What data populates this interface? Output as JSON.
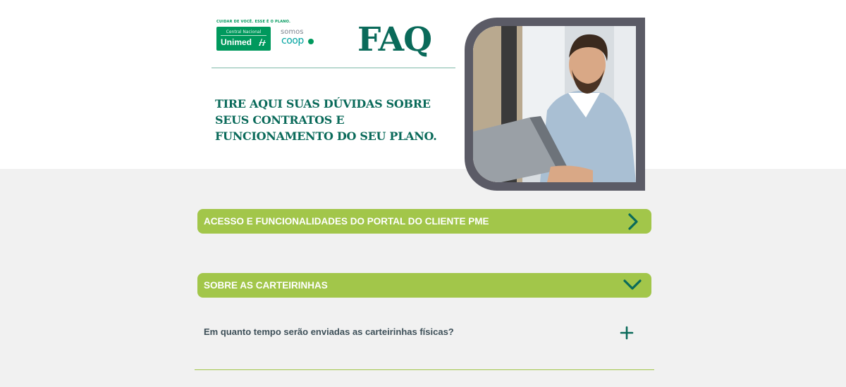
{
  "header": {
    "tagline": "CUIDAR DE VOCÊ. ESSE É O PLANO.",
    "unimed_logo": {
      "subtitle": "Central Nacional",
      "name": "Unimed"
    },
    "somos_coop": {
      "top": "somos",
      "bottom": "coop"
    },
    "title": "FAQ",
    "subtitle": "TIRE AQUI SUAS DÚVIDAS SOBRE SEUS CONTRATOS E FUNCIONAMENTO DO SEU PLANO."
  },
  "sections": [
    {
      "label": "ACESSO E FUNCIONALIDADES DO PORTAL DO CLIENTE PME",
      "state": "collapsed",
      "icon": "chevron-right-icon"
    },
    {
      "label": "SOBRE AS CARTEIRINHAS",
      "state": "expanded",
      "icon": "chevron-down-icon"
    }
  ],
  "questions": [
    {
      "text": "Em quanto tempo serão enviadas as carteirinhas físicas?",
      "icon": "plus-icon"
    }
  ],
  "colors": {
    "brand_green": "#00995d",
    "dark_teal": "#0a6a5a",
    "accordion_green": "#a2c64a",
    "frame_gray": "#5b5b66",
    "background": "#f1f1f1"
  }
}
